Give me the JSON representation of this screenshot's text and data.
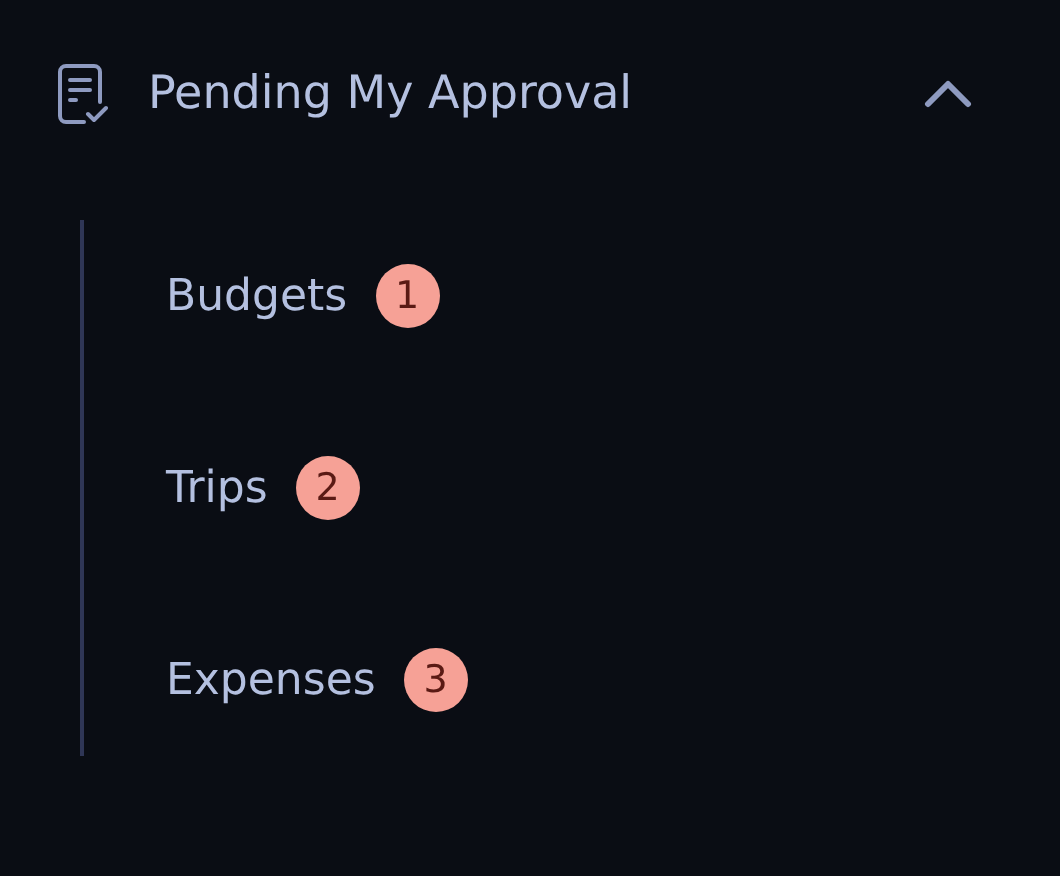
{
  "section": {
    "title": "Pending My Approval",
    "expanded": true,
    "items": [
      {
        "label": "Budgets",
        "count": "1"
      },
      {
        "label": "Trips",
        "count": "2"
      },
      {
        "label": "Expenses",
        "count": "3"
      }
    ]
  }
}
